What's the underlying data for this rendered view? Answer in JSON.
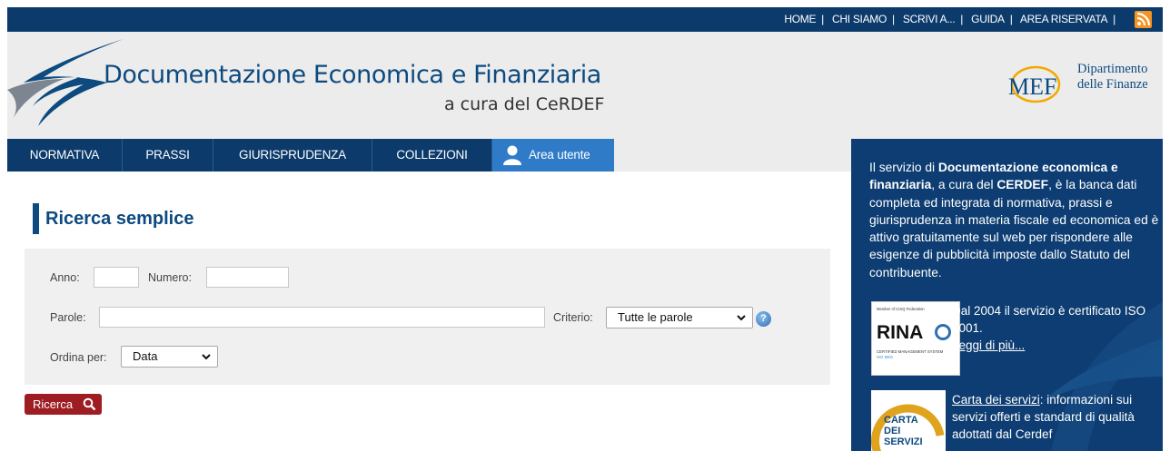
{
  "topbar": {
    "links": [
      "HOME",
      "CHI SIAMO",
      "SCRIVI A...",
      "GUIDA",
      "AREA RISERVATA"
    ],
    "rss_icon": "rss-icon"
  },
  "header": {
    "title": "Documentazione Economica e Finanziaria",
    "subtitle": "a cura del CeRDEF",
    "mef_logo_text": "MEF",
    "department_line1": "Dipartimento",
    "department_line2": "delle Finanze"
  },
  "nav": {
    "items": [
      "NORMATIVA",
      "PRASSI",
      "GIURISPRUDENZA",
      "COLLEZIONI"
    ],
    "user_area": "Area utente",
    "user_icon": "user-icon"
  },
  "main": {
    "section_title": "Ricerca semplice",
    "form": {
      "anno_label": "Anno:",
      "anno_value": "",
      "numero_label": "Numero:",
      "numero_value": "",
      "parole_label": "Parole:",
      "parole_value": "",
      "criterio_label": "Criterio:",
      "criterio_value": "Tutte le parole",
      "ordina_label": "Ordina per:",
      "ordina_value": "Data",
      "help_icon": "help-icon"
    },
    "search_button": "Ricerca",
    "search_icon": "search-icon"
  },
  "sidebar": {
    "intro_1": "Il servizio di ",
    "intro_bold_1": "Documentazione economica e finanziaria",
    "intro_2": ", a cura del ",
    "intro_bold_2": "CERDEF",
    "intro_3": ", è la banca dati completa ed integrata di normativa, prassi e giurisprudenza in materia fiscale ed economica ed è attivo gratuitamente sul web per rispondere alle esigenze di pubblicità imposte dallo Statuto del contribuente.",
    "cert_text": "Dal 2004 il servizio è certificato ISO 9001.",
    "cert_link": "Leggi di più...",
    "rina_logo": {
      "top": "Member of CISQ Federation",
      "brand": "RINA",
      "line1": "CERTIFIED MANAGEMENT SYSTEM",
      "line2": "ISO 9001"
    },
    "carta_logo": {
      "line1": "CARTA",
      "line2": "DEI",
      "line3": "SERVIZI"
    },
    "carta_link": "Carta dei servizi",
    "carta_text": ": informazioni sui servizi offerti e standard di qualità adottati dal Cerdef"
  },
  "colors": {
    "navy": "#0b3a6b",
    "brand_blue": "#0c4a80",
    "user_blue": "#2f7bc8",
    "button_red": "#9e1d23",
    "rss_orange": "#f7931e"
  }
}
